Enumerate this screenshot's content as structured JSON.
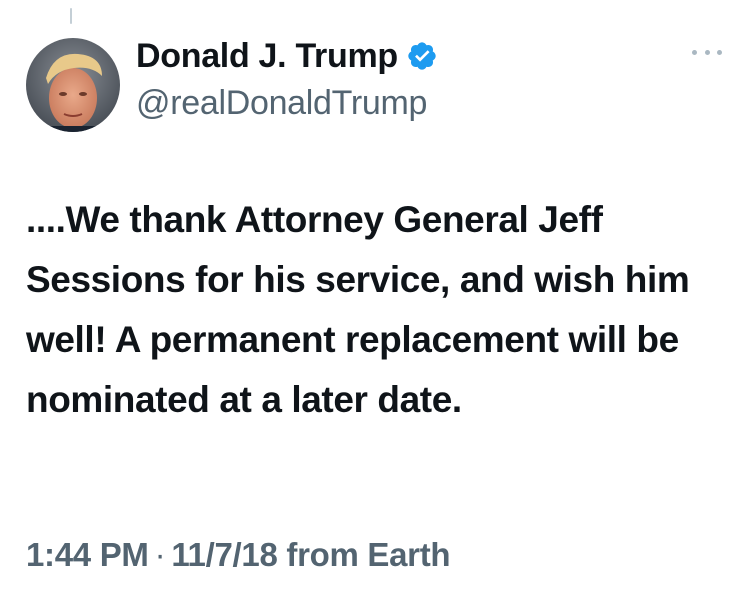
{
  "tweet": {
    "author": {
      "display_name": "Donald J. Trump",
      "handle": "@realDonaldTrump",
      "verified": true,
      "avatar_icon": "profile-photo"
    },
    "text": "....We thank Attorney General Jeff Sessions for his service, and wish him well! A permanent replacement will be nominated at a later date.",
    "time": "1:44 PM",
    "separator": "·",
    "date": "11/7/18",
    "source": "from Earth"
  },
  "colors": {
    "text_primary": "#0f1419",
    "text_secondary": "#536471",
    "verified_blue": "#1d9bf0",
    "more_dots": "#aab8c2"
  },
  "icons": {
    "verified": "verified-badge-icon",
    "more": "more-options-icon"
  }
}
